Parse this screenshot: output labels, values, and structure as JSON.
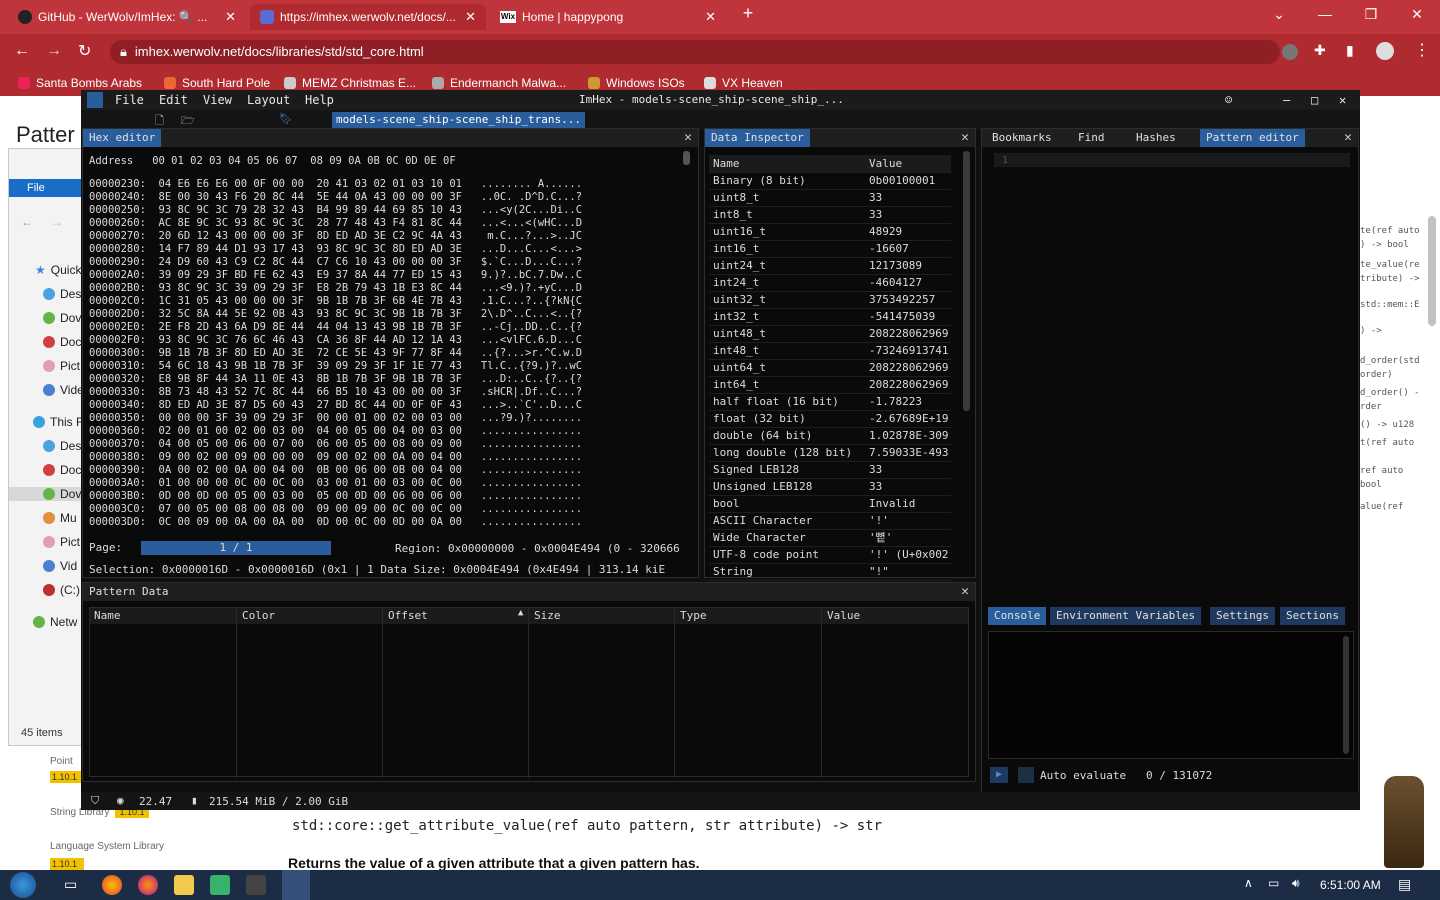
{
  "browser": {
    "tabs": [
      {
        "label": "GitHub - WerWolv/ImHex: 🔍 ..."
      },
      {
        "label": "https://imhex.werwolv.net/docs/..."
      },
      {
        "label": "Home | happypong"
      }
    ],
    "url": "imhex.werwolv.net/docs/libraries/std/std_core.html",
    "bookmarks": [
      "Santa Bombs Arabs",
      "South Hard Pole",
      "MEMZ Christmas E...",
      "Endermanch Malwa...",
      "Windows ISOs",
      "VX Heaven"
    ]
  },
  "page": {
    "heading_partial": "Patter",
    "right_snippets": [
      "te(ref auto",
      ") -> bool",
      "te_value(re",
      "tribute) ->",
      "std::mem::E",
      ") ->",
      "d_order(std",
      "order)",
      "d_order() -",
      "rder",
      "() -> u128",
      "t(ref auto",
      "ref auto",
      "bool",
      "alue(ref"
    ],
    "left_libs": [
      {
        "label": "Point",
        "badge": "1.10.1"
      },
      {
        "label": "String Library",
        "badge": "1.10.1"
      },
      {
        "label": "Language System Library",
        "badge": "1.10.1"
      }
    ],
    "code_line": "std::core::get_attribute_value(ref auto pattern, str attribute) -> str",
    "description": "Returns the value of a given attribute that a given pattern has."
  },
  "explorer": {
    "file_tab": "File",
    "items": [
      "Quick",
      "Des",
      "Dov",
      "Doc",
      "Pict",
      "Vide",
      "This F",
      "Des",
      "Doc",
      "Dov",
      "Mu",
      "Pict",
      "Vid",
      "(C:)",
      "Netw"
    ],
    "count": "45 items"
  },
  "imhex": {
    "menus": [
      "File",
      "Edit",
      "View",
      "Layout",
      "Help"
    ],
    "window_title": "ImHex - models-scene_ship-scene_ship_...",
    "file_tab": "models-scene_ship-scene_ship_trans...",
    "hex_editor": {
      "title": "Hex editor",
      "header": "Address   00 01 02 03 04 05 06 07  08 09 0A 0B 0C 0D 0E 0F",
      "rows": [
        "00000230:  04 E6 E6 E6 00 0F 00 00  20 41 03 02 01 03 10 01   ........ A......",
        "00000240:  8E 00 30 43 F6 20 8C 44  5E 44 0A 43 00 00 00 3F   ..0C. .D^D.C...?",
        "00000250:  93 8C 9C 3C 79 28 32 43  B4 99 89 44 69 85 10 43   ...<y(2C...Di..C",
        "00000260:  AC 8E 9C 3C 93 8C 9C 3C  28 77 48 43 F4 81 8C 44   ...<...<(wHC...D",
        "00000270:  20 6D 12 43 00 00 00 3F  8D ED AD 3E C2 9C 4A 43    m.C...?...>..JC",
        "00000280:  14 F7 89 44 D1 93 17 43  93 8C 9C 3C 8D ED AD 3E   ...D...C...<...>",
        "00000290:  24 D9 60 43 C9 C2 8C 44  C7 C6 10 43 00 00 00 3F   $.`C...D...C...?",
        "000002A0:  39 09 29 3F BD FE 62 43  E9 37 8A 44 77 ED 15 43   9.)?..bC.7.Dw..C",
        "000002B0:  93 8C 9C 3C 39 09 29 3F  E8 2B 79 43 1B E3 8C 44   ...<9.)?.+yC...D",
        "000002C0:  1C 31 05 43 00 00 00 3F  9B 1B 7B 3F 6B 4E 7B 43   .1.C...?..{?kN{C",
        "000002D0:  32 5C 8A 44 5E 92 0B 43  93 8C 9C 3C 9B 1B 7B 3F   2\\.D^..C...<..{?",
        "000002E0:  2E F8 2D 43 6A D9 8E 44  44 04 13 43 9B 1B 7B 3F   ..-Cj..DD..C..{?",
        "000002F0:  93 8C 9C 3C 76 6C 46 43  CA 36 8F 44 AD 12 1A 43   ...<vlFC.6.D...C",
        "00000300:  9B 1B 7B 3F 8D ED AD 3E  72 CE 5E 43 9F 77 8F 44   ..{?...>r.^C.w.D",
        "00000310:  54 6C 18 43 9B 1B 7B 3F  39 09 29 3F 1F 1E 77 43   Tl.C..{?9.)?..wC",
        "00000320:  E8 9B 8F 44 3A 11 0E 43  8B 1B 7B 3F 9B 1B 7B 3F   ...D:..C..{?..{?",
        "00000330:  8B 73 48 43 52 7C 8C 44  66 B5 10 43 00 00 00 3F   .sHCR|.Df..C...?",
        "00000340:  8D ED AD 3E 87 D5 60 43  27 BD 8C 44 0D 0F 0F 43   ...>..`C'..D...C",
        "00000350:  00 00 00 3F 39 09 29 3F  00 00 01 00 02 00 03 00   ...?9.)?........",
        "00000360:  02 00 01 00 02 00 03 00  04 00 05 00 04 00 03 00   ................",
        "00000370:  04 00 05 00 06 00 07 00  06 00 05 00 08 00 09 00   ................",
        "00000380:  09 00 02 00 09 00 00 00  09 00 02 00 0A 00 04 00   ................",
        "00000390:  0A 00 02 00 0A 00 04 00  0B 00 06 00 0B 00 04 00   ................",
        "000003A0:  01 00 00 00 0C 00 0C 00  03 00 01 00 03 00 0C 00   ................",
        "000003B0:  0D 00 0D 00 05 00 03 00  05 00 0D 00 06 00 06 00   ................",
        "000003C0:  07 00 05 00 08 00 08 00  09 00 09 00 0C 00 0C 00   ................",
        "000003D0:  0C 00 09 00 0A 00 0A 00  0D 00 0C 00 0D 00 0A 00   ................"
      ],
      "page_label": "Page:",
      "page_value": "1 / 1",
      "region": "Region: 0x00000000 - 0x0004E494 (0 - 320666",
      "selection": "Selection: 0x0000016D - 0x0000016D (0x1 | 1 Data Size: 0x0004E494 (0x4E494 | 313.14 kiE"
    },
    "data_inspector": {
      "title": "Data Inspector",
      "col_name": "Name",
      "col_value": "Value",
      "rows": [
        {
          "name": "Binary (8 bit)",
          "value": "0b00100001"
        },
        {
          "name": "uint8_t",
          "value": "33"
        },
        {
          "name": "int8_t",
          "value": "33"
        },
        {
          "name": "uint16_t",
          "value": "48929"
        },
        {
          "name": "int16_t",
          "value": "-16607"
        },
        {
          "name": "uint24_t",
          "value": "12173089"
        },
        {
          "name": "int24_t",
          "value": "-4604127"
        },
        {
          "name": "uint32_t",
          "value": "3753492257"
        },
        {
          "name": "int32_t",
          "value": "-541475039"
        },
        {
          "name": "uint48_t",
          "value": "208228062969"
        },
        {
          "name": "int48_t",
          "value": "-73246913741"
        },
        {
          "name": "uint64_t",
          "value": "208228062969"
        },
        {
          "name": "int64_t",
          "value": "208228062969"
        },
        {
          "name": "half float (16 bit)",
          "value": "-1.78223"
        },
        {
          "name": "float (32 bit)",
          "value": "-2.67689E+19"
        },
        {
          "name": "double (64 bit)",
          "value": "1.02878E-309"
        },
        {
          "name": "long double (128 bit)",
          "value": "7.59033E-493"
        },
        {
          "name": "Signed LEB128",
          "value": "33"
        },
        {
          "name": "Unsigned LEB128",
          "value": "33"
        },
        {
          "name": "bool",
          "value": "Invalid"
        },
        {
          "name": "ASCII Character",
          "value": "'!'"
        },
        {
          "name": "Wide Character",
          "value": "'뼡'"
        },
        {
          "name": "UTF-8 code point",
          "value": "'!' (U+0x002"
        },
        {
          "name": "String",
          "value": "\"!\""
        }
      ]
    },
    "right_panel": {
      "tabs": [
        "Bookmarks",
        "Find",
        "Hashes",
        "Pattern editor"
      ],
      "line_number": "1",
      "bottom_tabs": [
        "Console",
        "Environment Variables",
        "Settings",
        "Sections"
      ],
      "auto_evaluate": "Auto evaluate",
      "counter": "0 / 131072"
    },
    "pattern_data": {
      "title": "Pattern Data",
      "columns": [
        "Name",
        "Color",
        "Offset",
        "Size",
        "Type",
        "Value"
      ]
    },
    "status": {
      "fps": "22.47",
      "memory": "215.54 MiB / 2.00 GiB"
    }
  },
  "taskbar": {
    "time": "6:51:00 AM"
  },
  "colors": {
    "chrome_red": "#b02b30",
    "imhex_bg": "#0f0f0f",
    "imhex_accent": "#2a5d9c"
  }
}
